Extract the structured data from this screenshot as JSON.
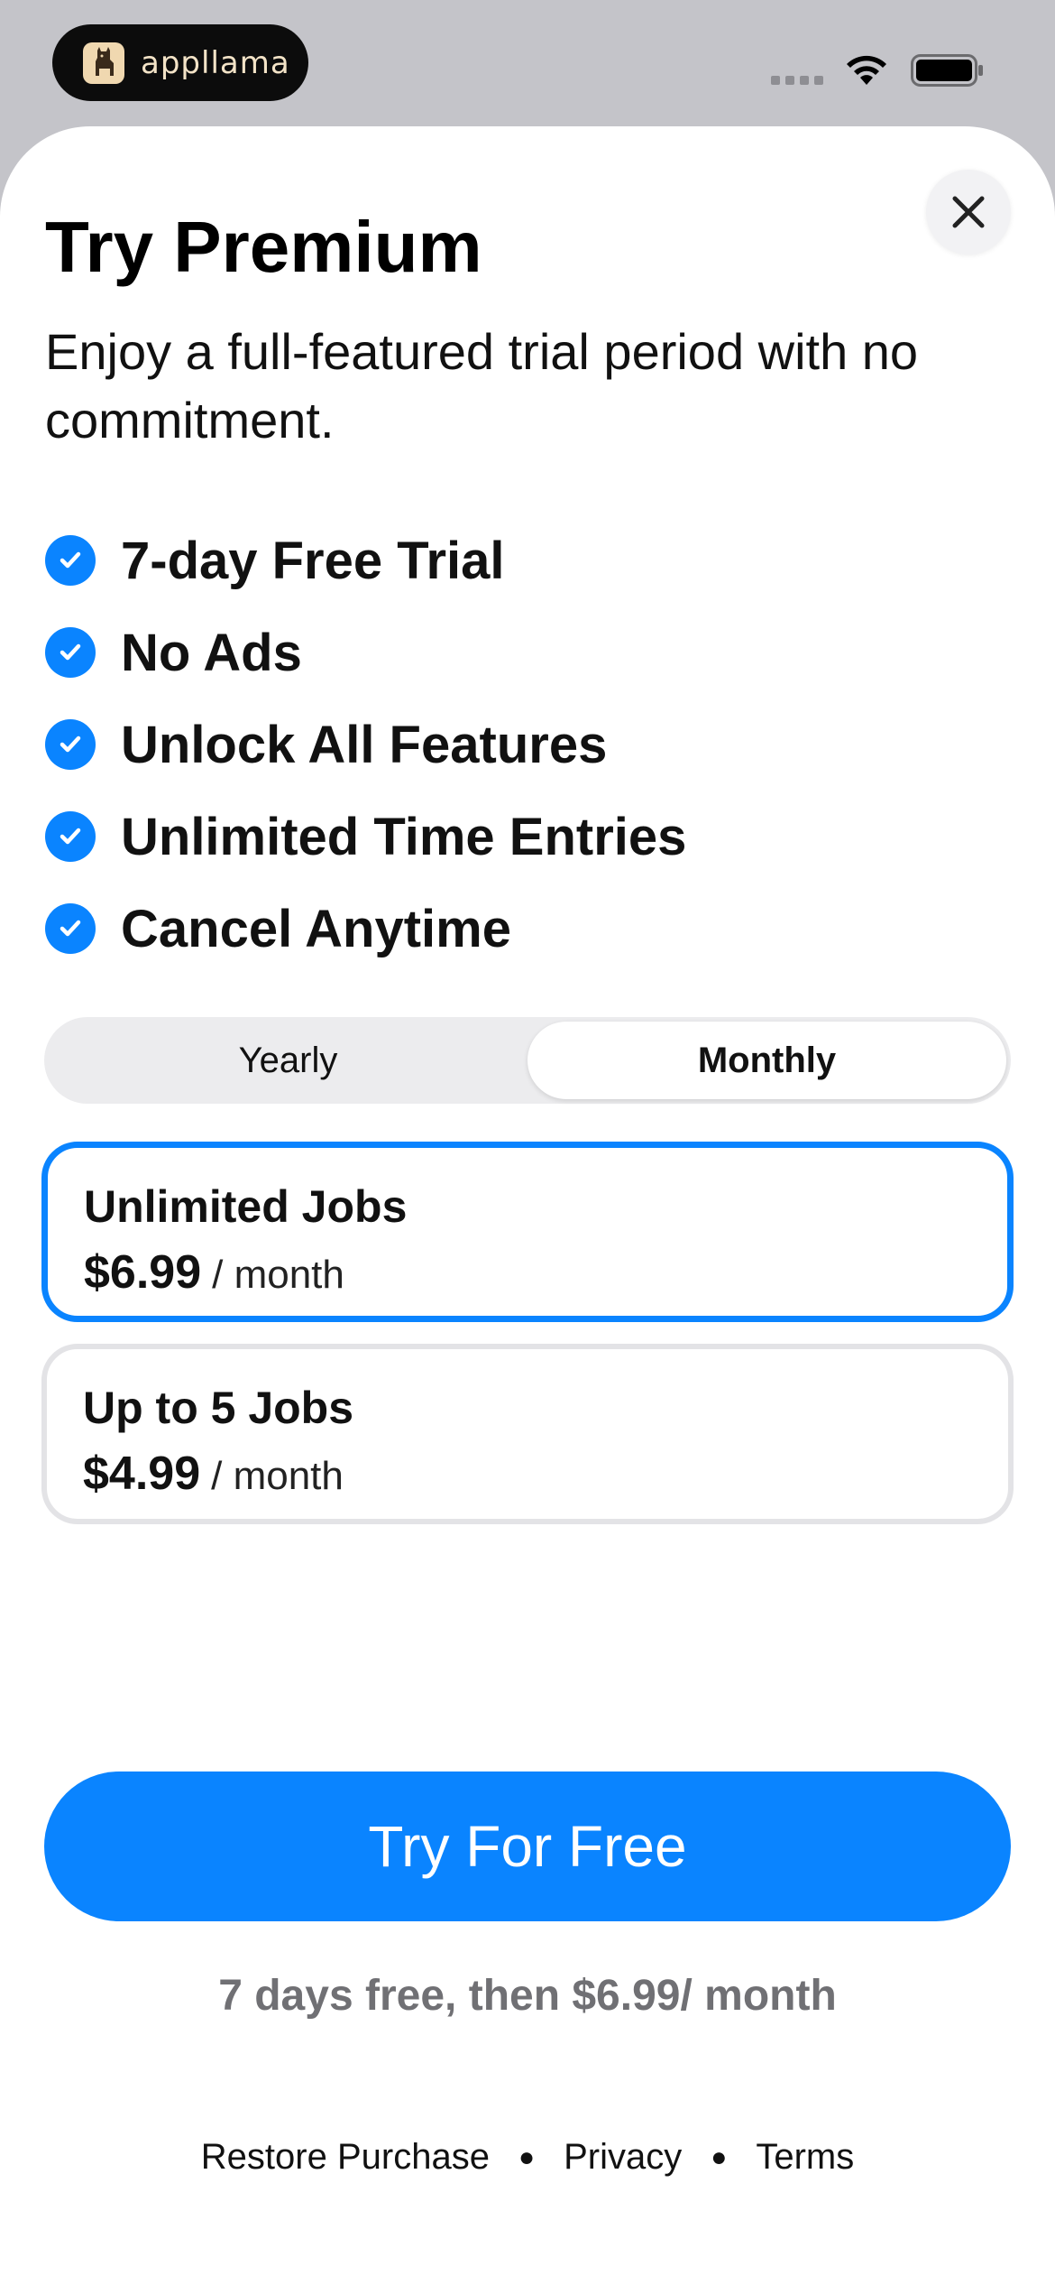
{
  "status_bar": {
    "app_name": "appllama",
    "icons": [
      "signal-dots-icon",
      "wifi-icon",
      "battery-icon"
    ]
  },
  "paywall": {
    "title": "Try Premium",
    "subtitle": "Enjoy a full-featured trial period with no commitment.",
    "close_icon": "close-icon",
    "features": [
      "7-day Free Trial",
      "No Ads",
      "Unlock All Features",
      "Unlimited Time Entries",
      "Cancel Anytime"
    ],
    "billing_toggle": {
      "options": [
        "Yearly",
        "Monthly"
      ],
      "selected": "Monthly"
    },
    "plans": [
      {
        "name": "Unlimited Jobs",
        "price": "$6.99",
        "period": "/ month",
        "selected": true
      },
      {
        "name": "Up to 5 Jobs",
        "price": "$4.99",
        "period": "/ month",
        "selected": false
      }
    ],
    "cta_label": "Try For Free",
    "trial_note": "7 days free, then $6.99/ month",
    "footer_links": [
      "Restore Purchase",
      "Privacy",
      "Terms"
    ]
  },
  "colors": {
    "accent": "#0a84ff",
    "status_bar_bg": "#c4c4c9",
    "muted_text": "#707074"
  }
}
